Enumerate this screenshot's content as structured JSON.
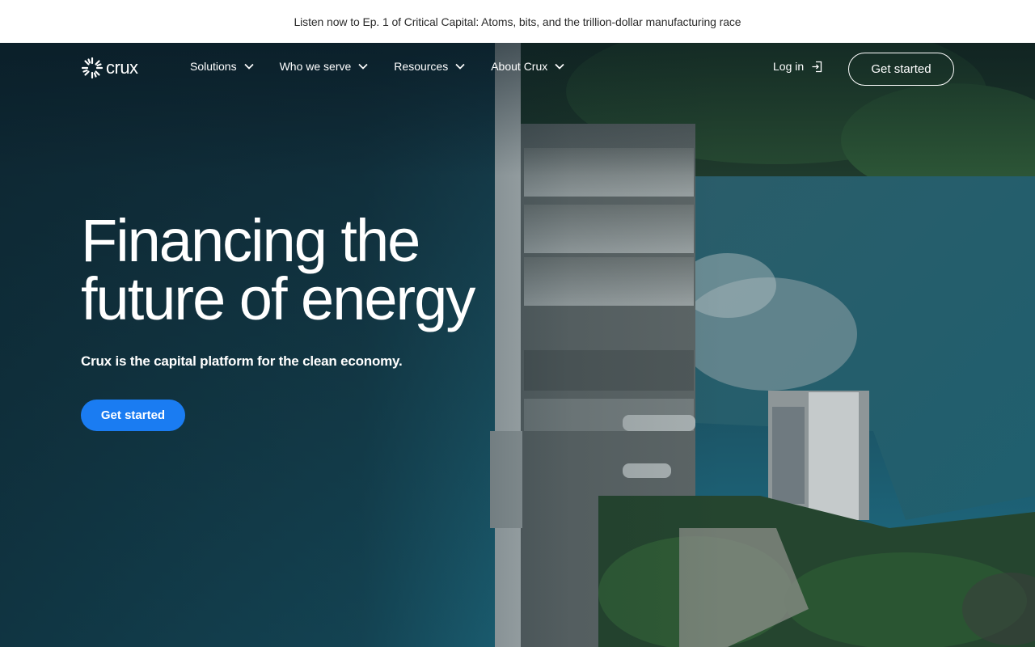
{
  "announcement": {
    "text": "Listen now to Ep. 1 of Critical Capital: Atoms, bits, and the trillion-dollar manufacturing race"
  },
  "nav": {
    "logo_text": "crux",
    "items": [
      {
        "label": "Solutions",
        "icon": "chevron-down-icon"
      },
      {
        "label": "Who we serve",
        "icon": "chevron-down-icon"
      },
      {
        "label": "Resources",
        "icon": "chevron-down-icon"
      },
      {
        "label": "About Crux",
        "icon": "chevron-down-icon"
      }
    ],
    "login_label": "Log in",
    "login_icon": "login-icon",
    "cta_label": "Get started"
  },
  "hero": {
    "headline_line1": "Financing the",
    "headline_line2": "future of energy",
    "subhead": "Crux is the capital platform for the clean economy.",
    "cta_label": "Get started",
    "image": "aerial-dam-photo"
  },
  "colors": {
    "accent_blue": "#1a7cf2",
    "hero_water": "#1d6378",
    "forest": "#2f5a35",
    "white": "#ffffff"
  }
}
